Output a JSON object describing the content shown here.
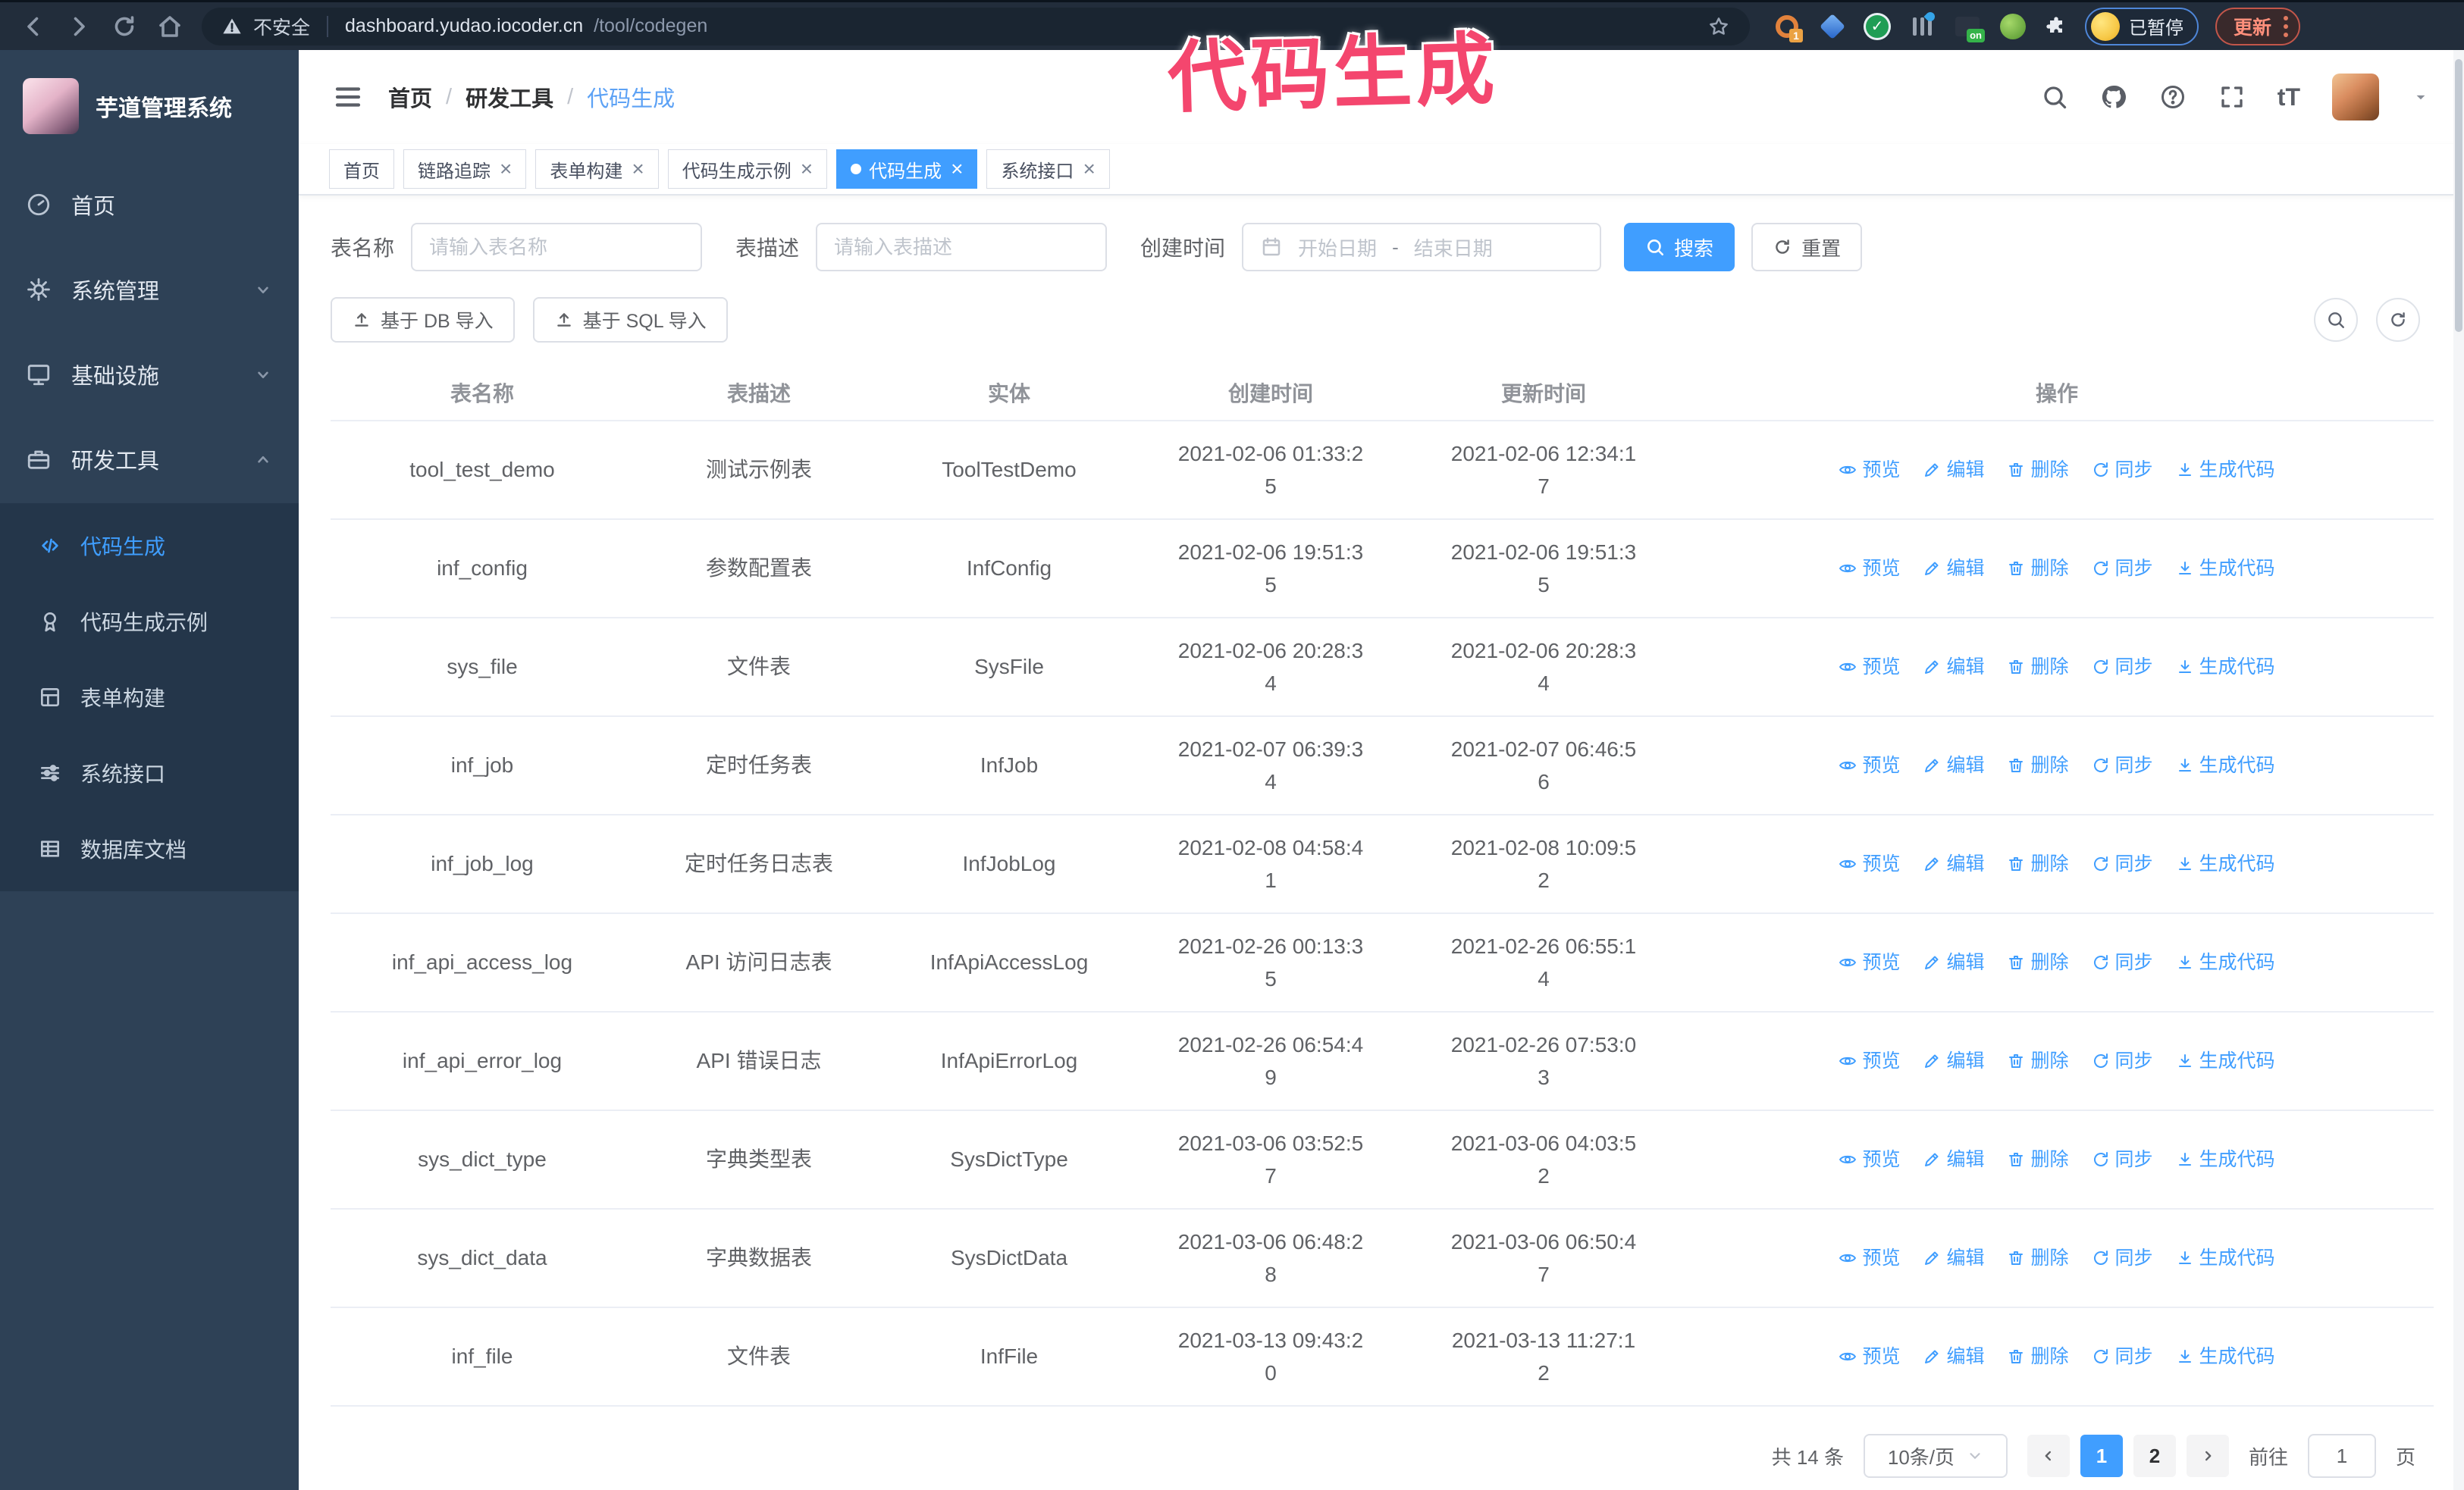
{
  "watermark": "代码生成",
  "colors": {
    "primary": "#409EFF",
    "watermark_pink": "#F4466E",
    "sidebar_bg": "#2E4156",
    "submenu_bg": "#24364A",
    "browser_bar_bg": "#222D3B",
    "active_tag_bg": "#409EFF",
    "table_header_text": "#909399",
    "table_cell_text": "#606266"
  },
  "browser": {
    "security_warning": "不安全",
    "url_host": "dashboard.yudao.iocoder.cn",
    "url_path": "/tool/codegen",
    "extension_badge": "1",
    "extension_on_label": "on",
    "extension_check": "✓",
    "paused_badge": "已暂停",
    "update_button": "更新"
  },
  "sidebar": {
    "logo_title": "芋道管理系统",
    "items": [
      {
        "label": "首页",
        "icon": "dashboard-icon",
        "expandable": false,
        "expanded": false
      },
      {
        "label": "系统管理",
        "icon": "gear-icon",
        "expandable": true,
        "expanded": false
      },
      {
        "label": "基础设施",
        "icon": "infra-icon",
        "expandable": true,
        "expanded": false
      },
      {
        "label": "研发工具",
        "icon": "tools-icon",
        "expandable": true,
        "expanded": true
      }
    ],
    "submenu": [
      {
        "label": "代码生成",
        "icon": "code-icon",
        "active": true
      },
      {
        "label": "代码生成示例",
        "icon": "medal-icon",
        "active": false
      },
      {
        "label": "表单构建",
        "icon": "form-icon",
        "active": false
      },
      {
        "label": "系统接口",
        "icon": "sliders-icon",
        "active": false
      },
      {
        "label": "数据库文档",
        "icon": "db-icon",
        "active": false
      }
    ]
  },
  "header": {
    "breadcrumb": [
      "首页",
      "研发工具",
      "代码生成"
    ],
    "font_size_tool": "tT"
  },
  "tabs": [
    {
      "label": "首页",
      "closable": false,
      "active": false
    },
    {
      "label": "链路追踪",
      "closable": true,
      "active": false
    },
    {
      "label": "表单构建",
      "closable": true,
      "active": false
    },
    {
      "label": "代码生成示例",
      "closable": true,
      "active": false
    },
    {
      "label": "代码生成",
      "closable": true,
      "active": true
    },
    {
      "label": "系统接口",
      "closable": true,
      "active": false
    }
  ],
  "filters": {
    "table_name_label": "表名称",
    "table_name_placeholder": "请输入表名称",
    "table_desc_label": "表描述",
    "table_desc_placeholder": "请输入表描述",
    "created_label": "创建时间",
    "date_start_placeholder": "开始日期",
    "date_separator": "-",
    "date_end_placeholder": "结束日期",
    "search_button": "搜索",
    "reset_button": "重置"
  },
  "toolbar": {
    "import_db_button": "基于 DB 导入",
    "import_sql_button": "基于 SQL 导入"
  },
  "table": {
    "columns": [
      "表名称",
      "表描述",
      "实体",
      "创建时间",
      "更新时间",
      "操作"
    ],
    "actions": [
      "预览",
      "编辑",
      "删除",
      "同步",
      "生成代码"
    ],
    "rows": [
      {
        "name": "tool_test_demo",
        "desc": "测试示例表",
        "entity": "ToolTestDemo",
        "created": "2021-02-06 01:33:25",
        "updated": "2021-02-06 12:34:17"
      },
      {
        "name": "inf_config",
        "desc": "参数配置表",
        "entity": "InfConfig",
        "created": "2021-02-06 19:51:35",
        "updated": "2021-02-06 19:51:35"
      },
      {
        "name": "sys_file",
        "desc": "文件表",
        "entity": "SysFile",
        "created": "2021-02-06 20:28:34",
        "updated": "2021-02-06 20:28:34"
      },
      {
        "name": "inf_job",
        "desc": "定时任务表",
        "entity": "InfJob",
        "created": "2021-02-07 06:39:34",
        "updated": "2021-02-07 06:46:56"
      },
      {
        "name": "inf_job_log",
        "desc": "定时任务日志表",
        "entity": "InfJobLog",
        "created": "2021-02-08 04:58:41",
        "updated": "2021-02-08 10:09:52"
      },
      {
        "name": "inf_api_access_log",
        "desc": "API 访问日志表",
        "entity": "InfApiAccessLog",
        "created": "2021-02-26 00:13:35",
        "updated": "2021-02-26 06:55:14"
      },
      {
        "name": "inf_api_error_log",
        "desc": "API 错误日志",
        "entity": "InfApiErrorLog",
        "created": "2021-02-26 06:54:49",
        "updated": "2021-02-26 07:53:03"
      },
      {
        "name": "sys_dict_type",
        "desc": "字典类型表",
        "entity": "SysDictType",
        "created": "2021-03-06 03:52:57",
        "updated": "2021-03-06 04:03:52"
      },
      {
        "name": "sys_dict_data",
        "desc": "字典数据表",
        "entity": "SysDictData",
        "created": "2021-03-06 06:48:28",
        "updated": "2021-03-06 06:50:47"
      },
      {
        "name": "inf_file",
        "desc": "文件表",
        "entity": "InfFile",
        "created": "2021-03-13 09:43:20",
        "updated": "2021-03-13 11:27:12"
      }
    ]
  },
  "pagination": {
    "total_label": "共 14 条",
    "page_size": "10条/页",
    "pages": [
      "1",
      "2"
    ],
    "current": "1",
    "goto_label": "前往",
    "goto_value": "1",
    "page_unit": "页"
  }
}
